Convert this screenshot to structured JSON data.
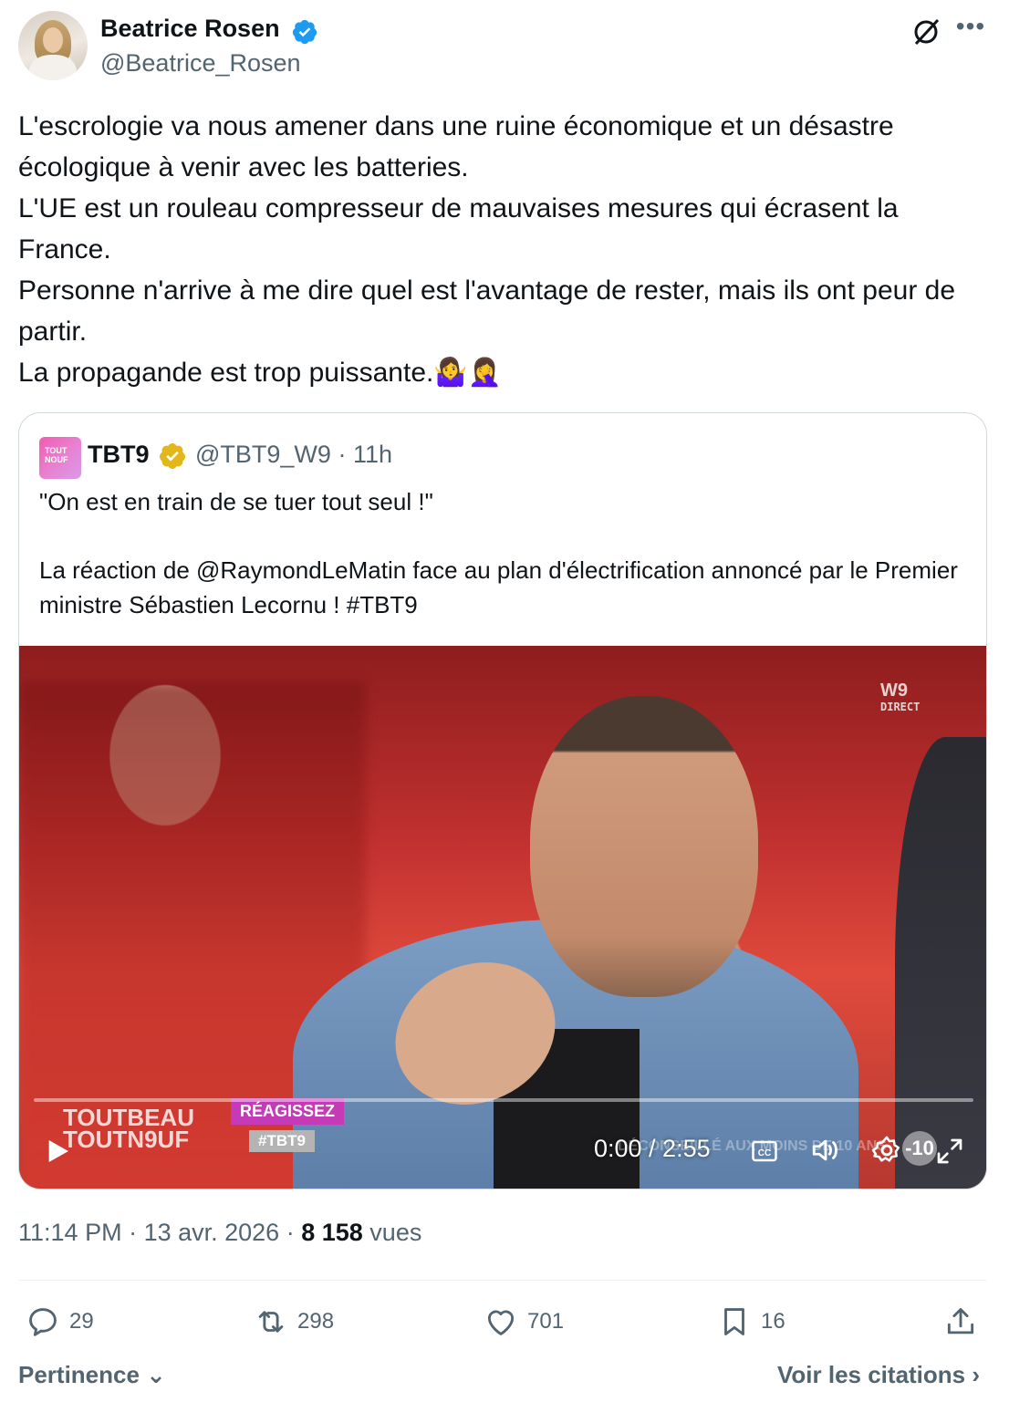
{
  "author": {
    "name": "Beatrice Rosen",
    "handle": "@Beatrice_Rosen",
    "verified_color": "#1d9bf0"
  },
  "tweet": {
    "lines": [
      "L'escrologie va nous amener dans une ruine économique et un désastre écologique à venir avec les batteries.",
      "L'UE est un rouleau compresseur de mauvaises mesures qui écrasent la France.",
      "Personne n'arrive à me dire quel est l'avantage de rester, mais ils ont peur de partir.",
      "La propagande est trop puissante.🤷‍♀️🤦‍♀️"
    ]
  },
  "quote": {
    "avatar_text_1": "TOUT",
    "avatar_text_2": "NOUF",
    "name": "TBT9",
    "handle": "@TBT9_W9",
    "time": "11h",
    "badge_color": "#e2b719",
    "line1": "\"On est en train de se tuer tout seul !\"",
    "line2_prefix": "La réaction de ",
    "mention": "@RaymondLeMatin",
    "line2_suffix": " face au plan d'électrification annoncé par le Premier ministre Sébastien Lecornu ! ",
    "hashtag": "#TBT9"
  },
  "video": {
    "channel_logo": "W9",
    "channel_sub": "DIRECT",
    "show_logo_line1": "TOUTBEAU",
    "show_logo_line2": "TOUTN9UF",
    "reagissez": "RÉAGISSEZ",
    "hashtag": "#TBT9",
    "warning": "DÉCONSEILLÉ AUX MOINS DE 10 ANS",
    "rating": "-10",
    "time_display": "0:00 / 2:55",
    "progress": 0
  },
  "meta": {
    "time": "11:14 PM",
    "date": "13 avr. 2026",
    "views_count": "8 158",
    "views_label": "vues"
  },
  "actions": {
    "replies": "29",
    "retweets": "298",
    "likes": "701",
    "bookmarks": "16"
  },
  "footer": {
    "sort_label": "Pertinence",
    "citations_label": "Voir les citations"
  }
}
